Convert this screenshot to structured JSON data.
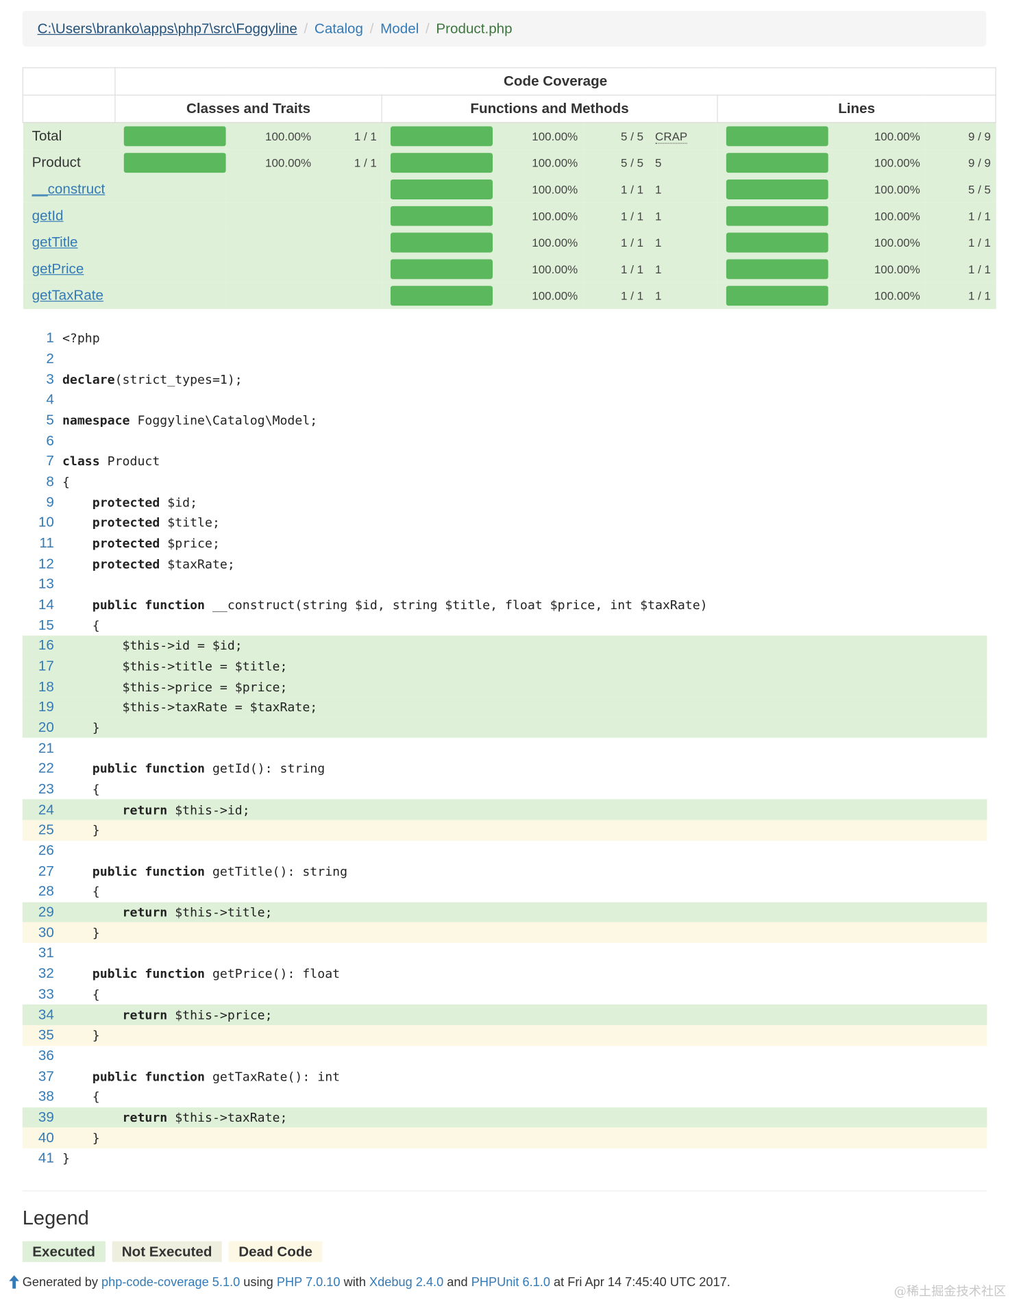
{
  "breadcrumb": {
    "items": [
      "C:\\Users\\branko\\apps\\php7\\src\\Foggyline",
      "Catalog",
      "Model"
    ],
    "active": "Product.php",
    "separator": "/"
  },
  "coverage": {
    "title": "Code Coverage",
    "headers": [
      "Classes and Traits",
      "Functions and Methods",
      "Lines"
    ],
    "rows": [
      {
        "name": "Total",
        "link": false,
        "classes": {
          "pct": 100,
          "pct_label": "100.00%",
          "count": "1 / 1"
        },
        "methods": {
          "pct": 100,
          "pct_label": "100.00%",
          "count": "5 / 5"
        },
        "crap": "CRAP",
        "lines": {
          "pct": 100,
          "pct_label": "100.00%",
          "count": "9 / 9"
        }
      },
      {
        "name": "Product",
        "link": false,
        "classes": {
          "pct": 100,
          "pct_label": "100.00%",
          "count": "1 / 1"
        },
        "methods": {
          "pct": 100,
          "pct_label": "100.00%",
          "count": "5 / 5"
        },
        "crap": "5",
        "lines": {
          "pct": 100,
          "pct_label": "100.00%",
          "count": "9 / 9"
        }
      },
      {
        "name": "__construct",
        "link": true,
        "methods": {
          "pct": 100,
          "pct_label": "100.00%",
          "count": "1 / 1"
        },
        "crap": "1",
        "lines": {
          "pct": 100,
          "pct_label": "100.00%",
          "count": "5 / 5"
        }
      },
      {
        "name": "getId",
        "link": true,
        "methods": {
          "pct": 100,
          "pct_label": "100.00%",
          "count": "1 / 1"
        },
        "crap": "1",
        "lines": {
          "pct": 100,
          "pct_label": "100.00%",
          "count": "1 / 1"
        }
      },
      {
        "name": "getTitle",
        "link": true,
        "methods": {
          "pct": 100,
          "pct_label": "100.00%",
          "count": "1 / 1"
        },
        "crap": "1",
        "lines": {
          "pct": 100,
          "pct_label": "100.00%",
          "count": "1 / 1"
        }
      },
      {
        "name": "getPrice",
        "link": true,
        "methods": {
          "pct": 100,
          "pct_label": "100.00%",
          "count": "1 / 1"
        },
        "crap": "1",
        "lines": {
          "pct": 100,
          "pct_label": "100.00%",
          "count": "1 / 1"
        }
      },
      {
        "name": "getTaxRate",
        "link": true,
        "methods": {
          "pct": 100,
          "pct_label": "100.00%",
          "count": "1 / 1"
        },
        "crap": "1",
        "lines": {
          "pct": 100,
          "pct_label": "100.00%",
          "count": "1 / 1"
        }
      }
    ]
  },
  "code": {
    "lines": [
      {
        "n": "1",
        "text": "<?php",
        "state": "none"
      },
      {
        "n": "2",
        "text": "",
        "state": "none"
      },
      {
        "n": "3",
        "text": "declare(strict_types=1);",
        "state": "none"
      },
      {
        "n": "4",
        "text": "",
        "state": "none"
      },
      {
        "n": "5",
        "text": "namespace Foggyline\\Catalog\\Model;",
        "state": "none"
      },
      {
        "n": "6",
        "text": "",
        "state": "none"
      },
      {
        "n": "7",
        "text": "class Product",
        "state": "none"
      },
      {
        "n": "8",
        "text": "{",
        "state": "none"
      },
      {
        "n": "9",
        "text": "    protected $id;",
        "state": "none"
      },
      {
        "n": "10",
        "text": "    protected $title;",
        "state": "none"
      },
      {
        "n": "11",
        "text": "    protected $price;",
        "state": "none"
      },
      {
        "n": "12",
        "text": "    protected $taxRate;",
        "state": "none"
      },
      {
        "n": "13",
        "text": "",
        "state": "none"
      },
      {
        "n": "14",
        "text": "    public function __construct(string $id, string $title, float $price, int $taxRate)",
        "state": "none"
      },
      {
        "n": "15",
        "text": "    {",
        "state": "none"
      },
      {
        "n": "16",
        "text": "        $this->id = $id;",
        "state": "covered"
      },
      {
        "n": "17",
        "text": "        $this->title = $title;",
        "state": "covered"
      },
      {
        "n": "18",
        "text": "        $this->price = $price;",
        "state": "covered"
      },
      {
        "n": "19",
        "text": "        $this->taxRate = $taxRate;",
        "state": "covered"
      },
      {
        "n": "20",
        "text": "    }",
        "state": "covered"
      },
      {
        "n": "21",
        "text": "",
        "state": "none"
      },
      {
        "n": "22",
        "text": "    public function getId(): string",
        "state": "none"
      },
      {
        "n": "23",
        "text": "    {",
        "state": "none"
      },
      {
        "n": "24",
        "text": "        return $this->id;",
        "state": "covered"
      },
      {
        "n": "25",
        "text": "    }",
        "state": "dead"
      },
      {
        "n": "26",
        "text": "",
        "state": "none"
      },
      {
        "n": "27",
        "text": "    public function getTitle(): string",
        "state": "none"
      },
      {
        "n": "28",
        "text": "    {",
        "state": "none"
      },
      {
        "n": "29",
        "text": "        return $this->title;",
        "state": "covered"
      },
      {
        "n": "30",
        "text": "    }",
        "state": "dead"
      },
      {
        "n": "31",
        "text": "",
        "state": "none"
      },
      {
        "n": "32",
        "text": "    public function getPrice(): float",
        "state": "none"
      },
      {
        "n": "33",
        "text": "    {",
        "state": "none"
      },
      {
        "n": "34",
        "text": "        return $this->price;",
        "state": "covered"
      },
      {
        "n": "35",
        "text": "    }",
        "state": "dead"
      },
      {
        "n": "36",
        "text": "",
        "state": "none"
      },
      {
        "n": "37",
        "text": "    public function getTaxRate(): int",
        "state": "none"
      },
      {
        "n": "38",
        "text": "    {",
        "state": "none"
      },
      {
        "n": "39",
        "text": "        return $this->taxRate;",
        "state": "covered"
      },
      {
        "n": "40",
        "text": "    }",
        "state": "dead"
      },
      {
        "n": "41",
        "text": "}",
        "state": "none"
      }
    ],
    "keywords": [
      "declare",
      "namespace",
      "class",
      "protected",
      "public",
      "function",
      "return"
    ]
  },
  "legend": {
    "title": "Legend",
    "items": [
      {
        "label": "Executed",
        "kind": "exec"
      },
      {
        "label": "Not Executed",
        "kind": "notexec"
      },
      {
        "label": "Dead Code",
        "kind": "dead"
      }
    ]
  },
  "footer": {
    "generated_by": "Generated by",
    "tool": "php-code-coverage 5.1.0",
    "using": "using",
    "php": "PHP 7.0.10",
    "with": "with",
    "xdebug": "Xdebug 2.4.0",
    "and": "and",
    "phpunit": "PHPUnit 6.1.0",
    "at": "at Fri Apr 14 7:45:40 UTC 2017."
  },
  "watermark": "@稀土掘金技术社区",
  "colors": {
    "covered_bg": "#dff0d8",
    "dead_bg": "#fcf8e3",
    "bar_fill": "#5cb85c",
    "link": "#337ab7"
  },
  "icons": [
    "arrow-up-icon"
  ]
}
